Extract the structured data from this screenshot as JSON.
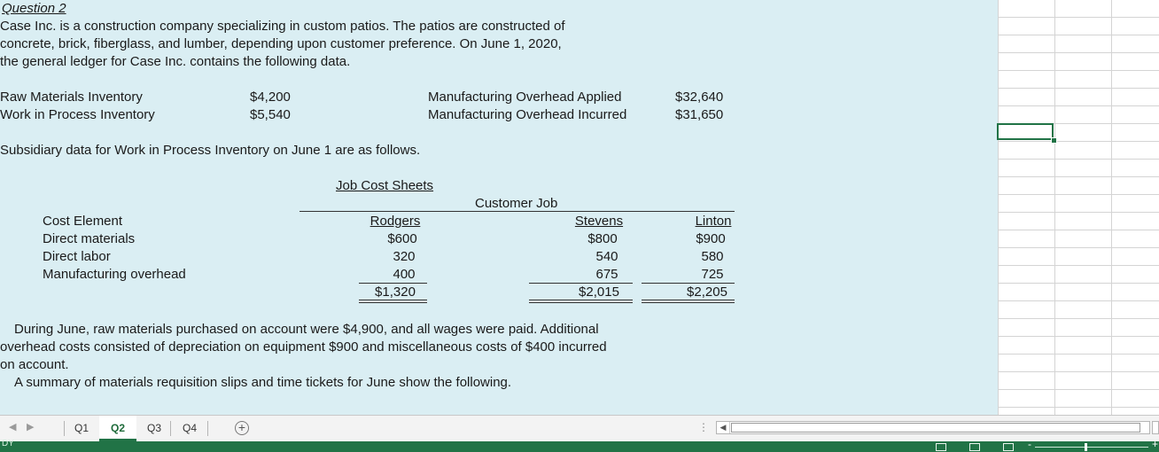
{
  "question_title": "Question 2",
  "intro_lines": [
    "Case Inc. is a construction company specializing in custom patios.  The patios are constructed of",
    "concrete, brick, fiberglass, and lumber, depending upon customer preference.  On June 1, 2020,",
    "the general ledger for Case Inc. contains the following data."
  ],
  "ledger": [
    {
      "label": "Raw Materials Inventory",
      "value": "$4,200",
      "label2": "Manufacturing Overhead Applied",
      "value2": "$32,640"
    },
    {
      "label": "Work in Process Inventory",
      "value": "$5,540",
      "label2": "Manufacturing Overhead Incurred",
      "value2": "$31,650"
    }
  ],
  "subsidiary_text": "Subsidiary data for Work in Process Inventory on June 1 are as follows.",
  "job_cost_sheets": {
    "title": "Job Cost Sheets",
    "group_header": "Customer Job",
    "row_header": "Cost Element",
    "columns": [
      "Rodgers",
      "Stevens",
      "Linton"
    ],
    "rows": [
      {
        "label": "Direct materials",
        "values": [
          "$600",
          "$800",
          "$900"
        ]
      },
      {
        "label": "Direct labor",
        "values": [
          "320",
          "540",
          "580"
        ]
      },
      {
        "label": "Manufacturing overhead",
        "values": [
          "400",
          "675",
          "725"
        ]
      }
    ],
    "totals": [
      "$1,320",
      "$2,015",
      "$2,205"
    ]
  },
  "june_lines": [
    "During June, raw materials purchased on account were $4,900, and all wages were paid.  Additional",
    "overhead costs consisted of depreciation on equipment $900 and miscellaneous costs of $400 incurred",
    "on account."
  ],
  "summary_line": "A summary of materials requisition slips and time tickets for June show the following.",
  "sheet_tabs": [
    "Q1",
    "Q2",
    "Q3",
    "Q4"
  ],
  "active_tab": "Q2",
  "status_mode": "DY",
  "colors": {
    "accent": "#217346",
    "cell_fill": "#daeef3"
  }
}
